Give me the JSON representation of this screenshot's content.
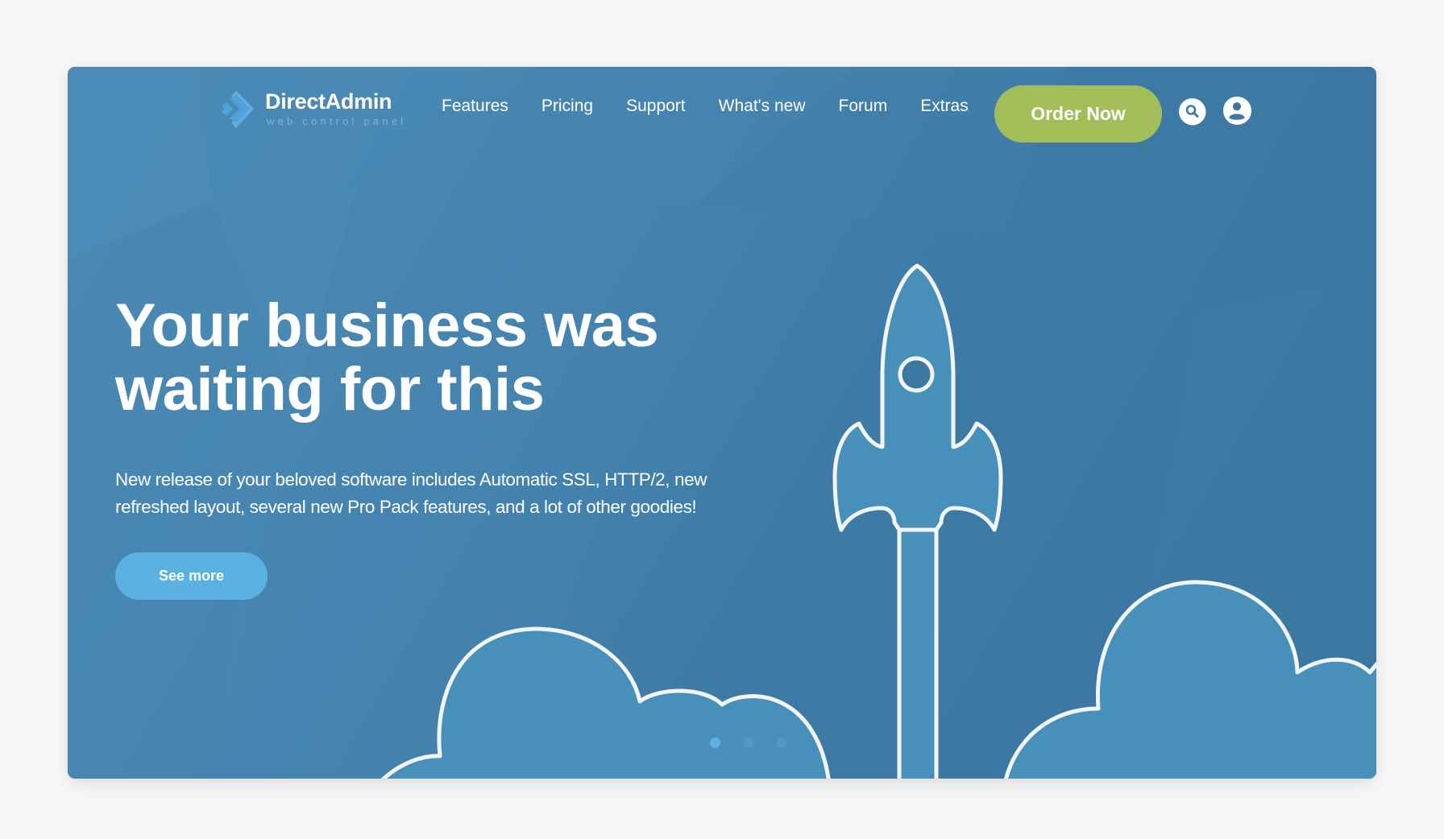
{
  "brand": {
    "name": "DirectAdmin",
    "tagline": "web control panel"
  },
  "nav": {
    "items": [
      {
        "label": "Features"
      },
      {
        "label": "Pricing"
      },
      {
        "label": "Support"
      },
      {
        "label": "What's new"
      },
      {
        "label": "Forum"
      },
      {
        "label": "Extras"
      }
    ],
    "order_label": "Order Now",
    "search_icon": "search-icon",
    "account_icon": "user-circle-icon"
  },
  "hero": {
    "title_line1": "Your business was",
    "title_line2": "waiting for this",
    "description_line1": "New release of your beloved software includes Automatic SSL, HTTP/2, new",
    "description_line2": "refreshed layout, several new Pro Pack features, and a lot of other goodies!",
    "cta_label": "See more",
    "illustration": "rocket-launch-with-clouds"
  },
  "carousel": {
    "slide_count": 3,
    "active_index": 0
  },
  "colors": {
    "background": "#f7f7f7",
    "card": "#4585b0",
    "order_button": "#a3bd58",
    "see_more_button": "#5bb1e1",
    "logo_accent": "#5db0e0",
    "illustration_fill": "#4690ba",
    "illustration_stroke": "#f2f4f5"
  }
}
